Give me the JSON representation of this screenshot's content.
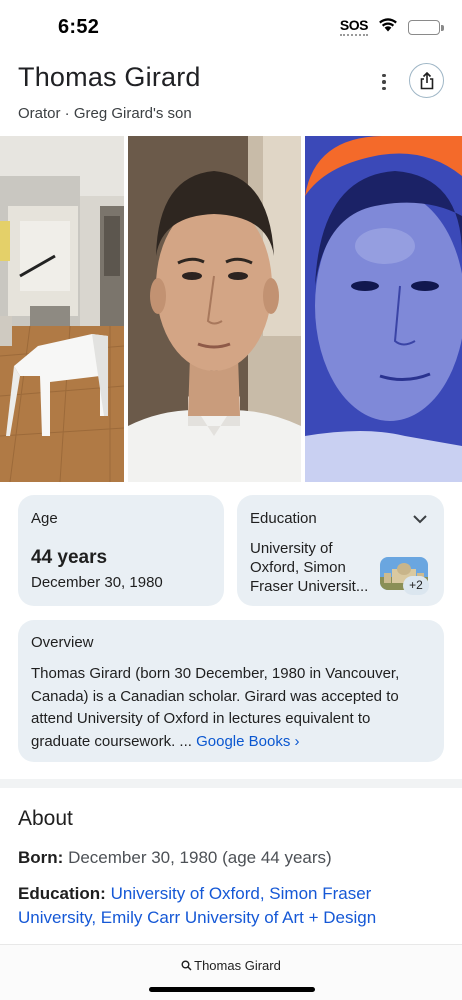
{
  "status_bar": {
    "time": "6:52",
    "sos_label": "SOS",
    "icons": [
      "wifi-icon",
      "battery-icon"
    ]
  },
  "header": {
    "title": "Thomas Girard",
    "subtitle": "Orator · Greg Girard's son",
    "more_icon": "more-vert-icon",
    "share_icon": "share-icon"
  },
  "photos": [
    {
      "name": "photo-interior-room"
    },
    {
      "name": "photo-portrait"
    },
    {
      "name": "photo-portrait-blue"
    }
  ],
  "age_card": {
    "label": "Age",
    "value": "44 years",
    "date": "December 30, 1980"
  },
  "education_card": {
    "label": "Education",
    "text": "University of Oxford, Simon Fraser Universit...",
    "more_count": "+2",
    "chevron_icon": "chevron-down-icon"
  },
  "overview_card": {
    "label": "Overview",
    "text": "Thomas Girard (born 30 December, 1980 in Vancouver, Canada) is a Canadian scholar. Girard was accepted to attend University of Oxford in lectures equivalent to graduate coursework. ... ",
    "source_link": "Google Books",
    "source_chevron": "›"
  },
  "about": {
    "title": "About",
    "born_key": "Born:",
    "born_value": "December 30, 1980 (age 44 years)",
    "education_key": "Education:",
    "education_value": "University of Oxford, Simon Fraser University, Emily Carr University of Art + Design"
  },
  "bottom_bar": {
    "query": "Thomas Girard",
    "search_icon": "search-icon"
  },
  "colors": {
    "card_bg": "#e9eff4",
    "link": "#0b57d0",
    "about_link": "#1558d6",
    "portrait_tint": "#3b49b8",
    "orange_ring": "#f46a2a"
  }
}
